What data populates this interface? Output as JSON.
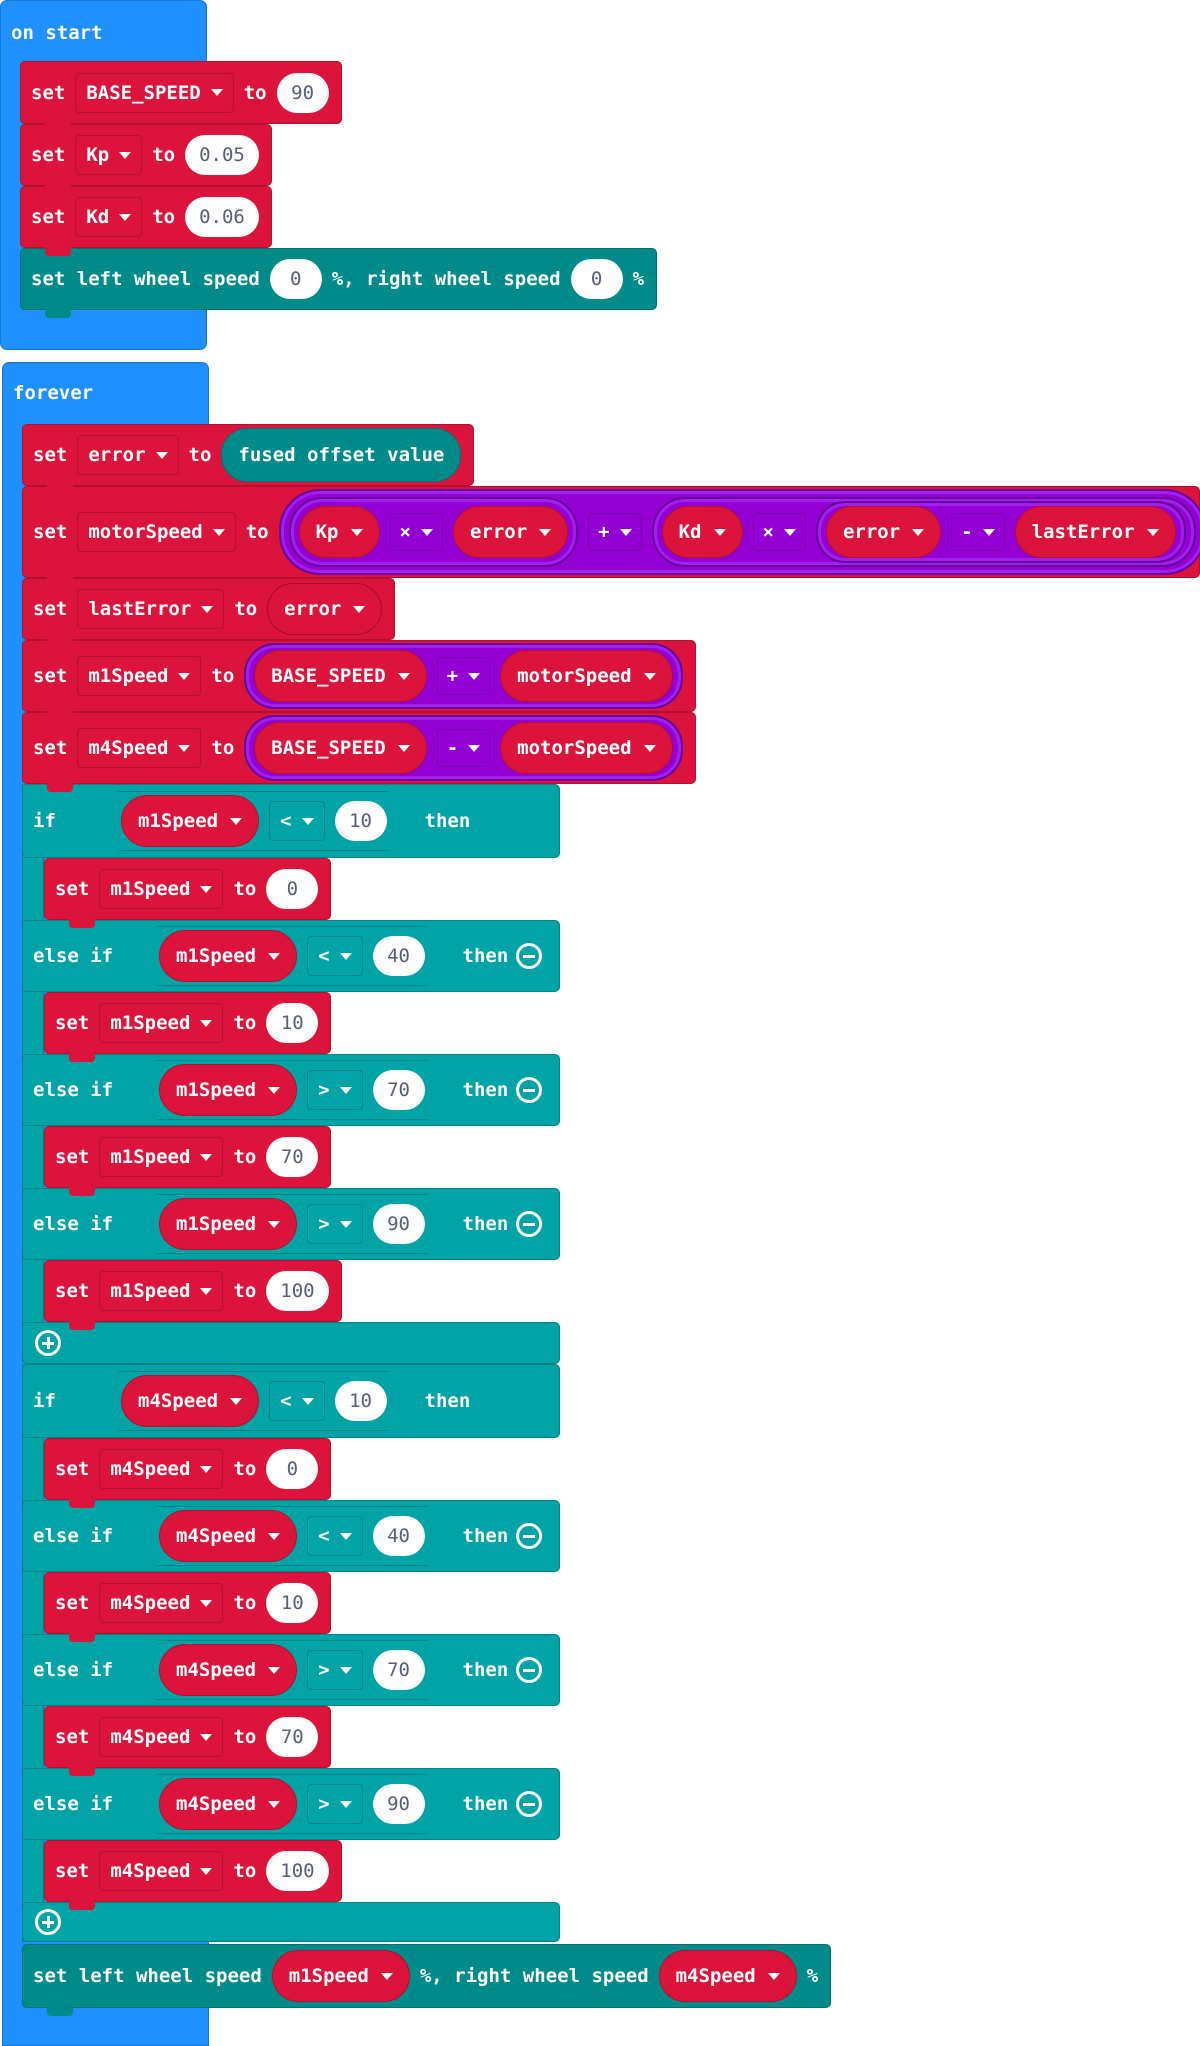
{
  "on_start": {
    "label": "on start",
    "rows": [
      {
        "kw": "set",
        "var": "BASE_SPEED",
        "to": "to",
        "value": "90"
      },
      {
        "kw": "set",
        "var": "Kp",
        "to": "to",
        "value": "0.05"
      },
      {
        "kw": "set",
        "var": "Kd",
        "to": "to",
        "value": "0.06"
      }
    ],
    "wheels": {
      "part1": "set left wheel speed",
      "left": "0",
      "part2": "%, right wheel speed",
      "right": "0",
      "part3": "%"
    }
  },
  "forever": {
    "label": "forever",
    "error_row": {
      "kw": "set",
      "var": "error",
      "to": "to",
      "reporter": "fused offset value"
    },
    "motor_row": {
      "kw": "set",
      "var": "motorSpeed",
      "to": "to",
      "a": "Kp",
      "op1": "×",
      "b": "error",
      "op2": "+",
      "c": "Kd",
      "op3": "×",
      "d": "error",
      "op4": "-",
      "e": "lastError"
    },
    "last_row": {
      "kw": "set",
      "var": "lastError",
      "to": "to",
      "value": "error"
    },
    "m1_row": {
      "kw": "set",
      "var": "m1Speed",
      "to": "to",
      "a": "BASE_SPEED",
      "op": "+",
      "b": "motorSpeed"
    },
    "m4_row": {
      "kw": "set",
      "var": "m4Speed",
      "to": "to",
      "a": "BASE_SPEED",
      "op": "-",
      "b": "motorSpeed"
    },
    "if1": {
      "branches": [
        {
          "kw": "if",
          "var": "m1Speed",
          "op": "<",
          "cmp": "10",
          "then": "then",
          "set": "set",
          "setvar": "m1Speed",
          "to": "to",
          "val": "0"
        },
        {
          "kw": "else if",
          "var": "m1Speed",
          "op": "<",
          "cmp": "40",
          "then": "then",
          "set": "set",
          "setvar": "m1Speed",
          "to": "to",
          "val": "10"
        },
        {
          "kw": "else if",
          "var": "m1Speed",
          "op": ">",
          "cmp": "70",
          "then": "then",
          "set": "set",
          "setvar": "m1Speed",
          "to": "to",
          "val": "70"
        },
        {
          "kw": "else if",
          "var": "m1Speed",
          "op": ">",
          "cmp": "90",
          "then": "then",
          "set": "set",
          "setvar": "m1Speed",
          "to": "to",
          "val": "100"
        }
      ]
    },
    "if2": {
      "branches": [
        {
          "kw": "if",
          "var": "m4Speed",
          "op": "<",
          "cmp": "10",
          "then": "then",
          "set": "set",
          "setvar": "m4Speed",
          "to": "to",
          "val": "0"
        },
        {
          "kw": "else if",
          "var": "m4Speed",
          "op": "<",
          "cmp": "40",
          "then": "then",
          "set": "set",
          "setvar": "m4Speed",
          "to": "to",
          "val": "10"
        },
        {
          "kw": "else if",
          "var": "m4Speed",
          "op": ">",
          "cmp": "70",
          "then": "then",
          "set": "set",
          "setvar": "m4Speed",
          "to": "to",
          "val": "70"
        },
        {
          "kw": "else if",
          "var": "m4Speed",
          "op": ">",
          "cmp": "90",
          "then": "then",
          "set": "set",
          "setvar": "m4Speed",
          "to": "to",
          "val": "100"
        }
      ]
    },
    "wheels": {
      "part1": "set left wheel speed",
      "left": "m1Speed",
      "part2": "%, right wheel speed",
      "right": "m4Speed",
      "part3": "%"
    }
  },
  "colors": {
    "event": "#1e90ff",
    "variables": "#dc143c",
    "logic": "#00a4a6",
    "math": "#9400d3",
    "robot": "#008b8b"
  },
  "icons": {
    "dropdown": "triangle-down-icon",
    "remove": "minus-circle-icon",
    "add": "plus-circle-icon"
  }
}
